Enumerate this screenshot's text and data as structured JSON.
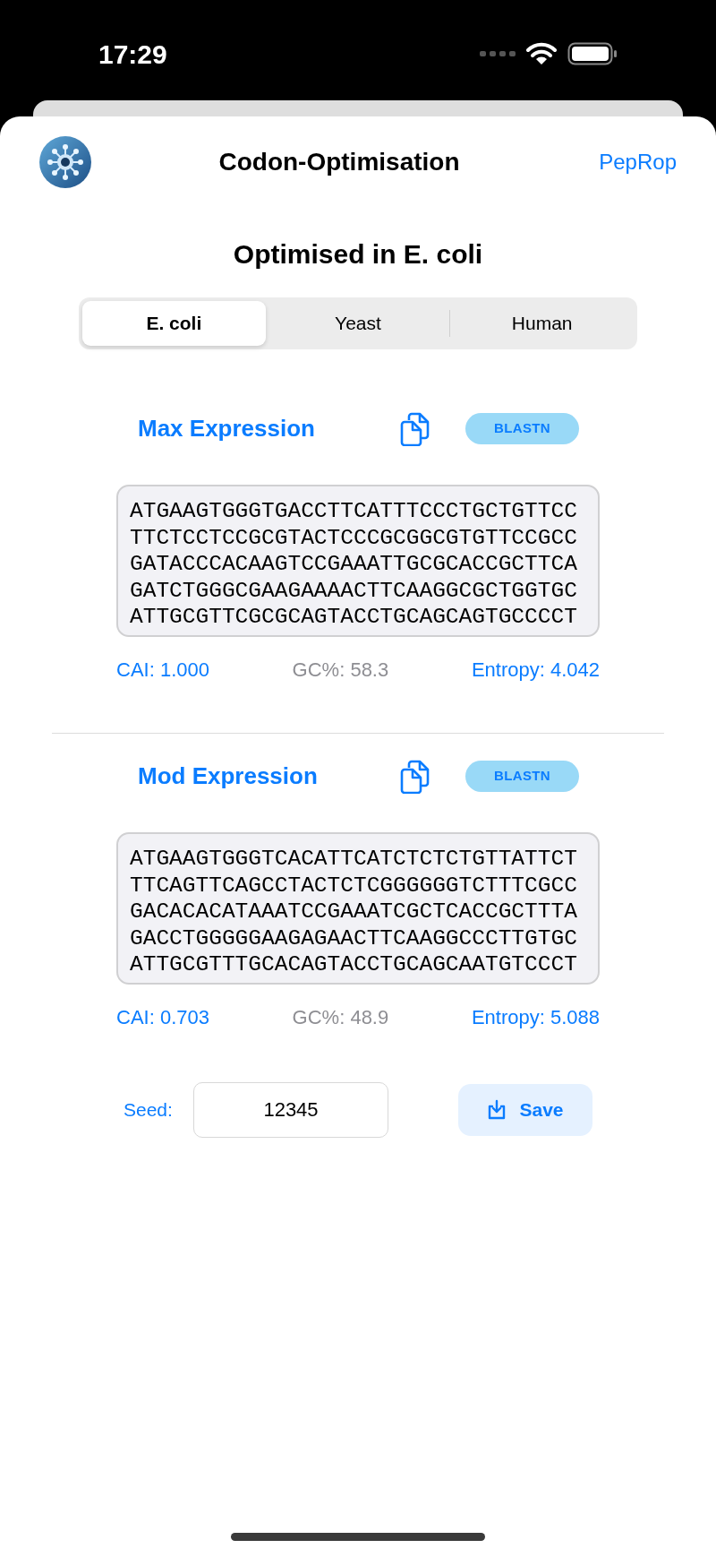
{
  "status_bar": {
    "time": "17:29"
  },
  "header": {
    "title": "Codon-Optimisation",
    "link": "PepRop"
  },
  "heading": "Optimised in E. coli",
  "tabs": [
    {
      "label": "E. coli",
      "selected": true
    },
    {
      "label": "Yeast",
      "selected": false
    },
    {
      "label": "Human",
      "selected": false
    }
  ],
  "sections": [
    {
      "title": "Max Expression",
      "blast": "BLASTN",
      "sequence": [
        "ATGAAGTGGGTGACCTTCATTTCCCTGCTGTTCC",
        "TTCTCCTCCGCGTACTCCCGCGGCGTGTTCCGCC",
        "GATACCCACAAGTCCGAAATTGCGCACCGCTTCA",
        "GATCTGGGCGAAGAAAACTTCAAGGCGCTGGTGC",
        "ATTGCGTTCGCGCAGTACCTGCAGCAGTGCCCCT"
      ],
      "cai": "CAI: 1.000",
      "gc": "GC%: 58.3",
      "entropy": "Entropy: 4.042"
    },
    {
      "title": "Mod Expression",
      "blast": "BLASTN",
      "sequence": [
        "ATGAAGTGGGTCACATTCATCTCTCTGTTATTCT",
        "TTCAGTTCAGCCTACTCTCGGGGGGTCTTTCGCC",
        "GACACACATAAATCCGAAATCGCTCACCGCTTTA",
        "GACCTGGGGGAAGAGAACTTCAAGGCCCTTGTGC",
        "ATTGCGTTTGCACAGTACCTGCAGCAATGTCCCT"
      ],
      "cai": "CAI: 0.703",
      "gc": "GC%: 48.9",
      "entropy": "Entropy: 5.088"
    }
  ],
  "seed": {
    "label": "Seed:",
    "value": "12345"
  },
  "save_button": "Save"
}
